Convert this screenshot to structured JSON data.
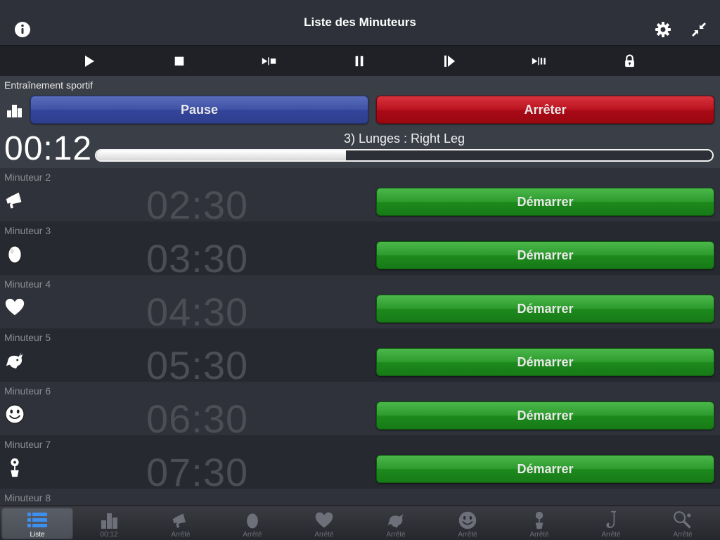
{
  "header": {
    "title": "Liste des Minuteurs",
    "left_icon": "info-icon",
    "right_icons": [
      "gear-icon",
      "collapse-arrows-icon"
    ]
  },
  "toolbar": {
    "buttons": [
      "play-icon",
      "stop-icon",
      "play-stop-icon",
      "pause-icon",
      "step-forward-icon",
      "play-pause-icon",
      "lock-icon"
    ]
  },
  "active_timer": {
    "name": "Entraînement sportif",
    "pause_label": "Pause",
    "stop_label": "Arrêter",
    "time": "00:12",
    "step": "3) Lunges : Right Leg",
    "progress": 0.405
  },
  "timers": [
    {
      "name": "Minuteur 2",
      "time": "02:30",
      "icon": "megaphone-icon",
      "button": "Démarrer"
    },
    {
      "name": "Minuteur 3",
      "time": "03:30",
      "icon": "egg-icon",
      "button": "Démarrer"
    },
    {
      "name": "Minuteur 4",
      "time": "04:30",
      "icon": "heart-icon",
      "button": "Démarrer"
    },
    {
      "name": "Minuteur 5",
      "time": "05:30",
      "icon": "bull-icon",
      "button": "Démarrer"
    },
    {
      "name": "Minuteur 6",
      "time": "06:30",
      "icon": "smiley-icon",
      "button": "Démarrer"
    },
    {
      "name": "Minuteur 7",
      "time": "07:30",
      "icon": "flower-pot-icon",
      "button": "Démarrer"
    },
    {
      "name": "Minuteur 8",
      "time": "",
      "icon": "",
      "button": ""
    }
  ],
  "tabs": [
    {
      "label": "Liste",
      "icon": "list-icon",
      "selected": true
    },
    {
      "label": "00:12",
      "icon": "bar-chart-icon",
      "selected": false
    },
    {
      "label": "Arrêté",
      "icon": "megaphone-icon",
      "selected": false
    },
    {
      "label": "Arrêté",
      "icon": "egg-icon",
      "selected": false
    },
    {
      "label": "Arrêté",
      "icon": "heart-icon",
      "selected": false
    },
    {
      "label": "Arrêté",
      "icon": "bull-icon",
      "selected": false
    },
    {
      "label": "Arrêté",
      "icon": "smiley-icon",
      "selected": false
    },
    {
      "label": "Arrêté",
      "icon": "flower-pot-icon",
      "selected": false
    },
    {
      "label": "Arrêté",
      "icon": "saxophone-icon",
      "selected": false
    },
    {
      "label": "Arrêté",
      "icon": "tennis-racket-icon",
      "selected": false
    }
  ],
  "colors": {
    "pause_button": "#3e51a5",
    "stop_button": "#bb1420",
    "start_button": "#2c9a2c",
    "background": "#2b2e35"
  }
}
